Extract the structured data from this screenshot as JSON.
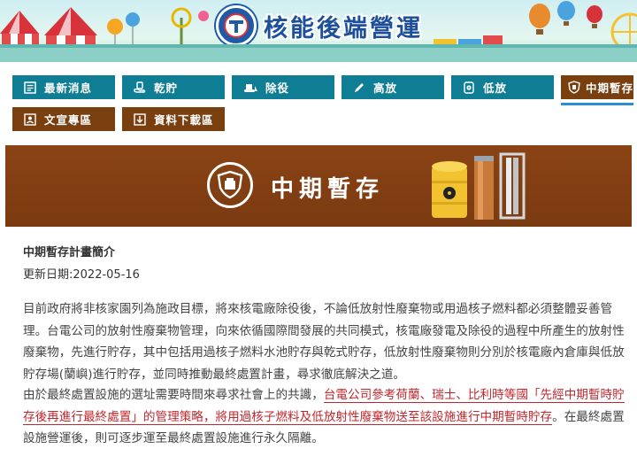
{
  "site": {
    "title": "核能後端營運"
  },
  "nav": {
    "row1": [
      {
        "label": "最新消息",
        "icon": "newspaper-icon"
      },
      {
        "label": "乾貯",
        "icon": "hand-icon"
      },
      {
        "label": "除役",
        "icon": "bulldozer-icon"
      },
      {
        "label": "高放",
        "icon": "pencil-icon"
      },
      {
        "label": "低放",
        "icon": "radiation-barrel-icon"
      },
      {
        "label": "中期暫存",
        "icon": "shield-icon",
        "active": true
      }
    ],
    "row2": [
      {
        "label": "文宣專區",
        "icon": "person-document-icon"
      },
      {
        "label": "資料下載區",
        "icon": "download-icon"
      }
    ]
  },
  "hero": {
    "title": "中期暫存"
  },
  "article": {
    "heading": "中期暫存計畫簡介",
    "updated": "更新日期:2022-05-16",
    "p1": "目前政府將非核家園列為施政目標，將來核電廠除役後，不論低放射性廢棄物或用過核子燃料都必須整體妥善管理。台電公司的放射性廢棄物管理，向來依循國際間發展的共同模式，核電廠發電及除役的過程中所產生的放射性廢棄物，先進行貯存，其中包括用過核子燃料水池貯存與乾式貯存，低放射性廢棄物則分別於核電廠內倉庫與低放貯存場(蘭嶼)進行貯存，並同時推動最終處置計畫，尋求徹底解決之道。",
    "p2_a": "由於最終處置設施的選址需要時間來尋求社會上的共識，",
    "p2_hl": "台電公司參考荷蘭、瑞士、比利時等國「先經中期暫時貯存後再進行最終處置」的管理策略，將用過核子燃料及低放射性廢棄物送至該設施進行中期暫時貯存",
    "p2_b": "。在最終處置設施營運後，則可逐步運至最終處置設施進行永久隔離。"
  },
  "colors": {
    "teal": "#0f7e94",
    "brown": "#7a3f0e",
    "highlight": "#c1272d",
    "active_underline": "#2b8fd6"
  }
}
